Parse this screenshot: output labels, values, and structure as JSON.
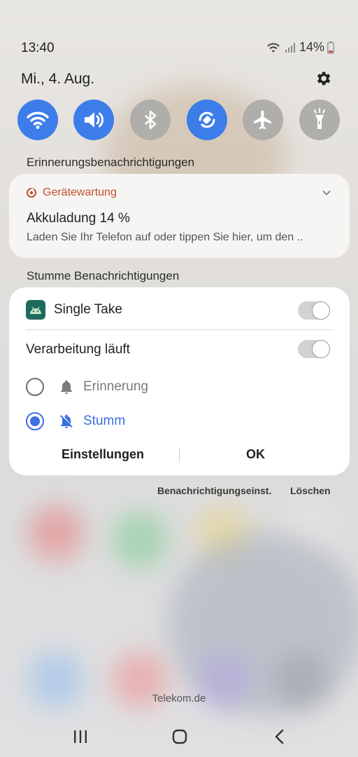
{
  "status_bar": {
    "time": "13:40",
    "battery": "14%"
  },
  "header": {
    "date": "Mi., 4. Aug."
  },
  "quick_settings": [
    {
      "name": "wifi",
      "state": "on"
    },
    {
      "name": "sound",
      "state": "on"
    },
    {
      "name": "bluetooth",
      "state": "off"
    },
    {
      "name": "auto-rotate",
      "state": "on"
    },
    {
      "name": "airplane",
      "state": "off"
    },
    {
      "name": "flashlight",
      "state": "off"
    }
  ],
  "sections": {
    "reminders_title": "Erinnerungsbenachrichtigungen",
    "silent_title": "Stumme Benachrichtigungen"
  },
  "reminder_card": {
    "app_name": "Gerätewartung",
    "title": "Akkuladung 14 %",
    "text": "Laden Sie Ihr Telefon auf oder tippen Sie hier, um den .."
  },
  "popup": {
    "app_name": "Single Take",
    "app_toggle": "off",
    "channel_label": "Verarbeitung läuft",
    "channel_toggle": "off",
    "options": [
      {
        "label": "Erinnerung",
        "selected": false
      },
      {
        "label": "Stumm",
        "selected": true
      }
    ],
    "settings_button": "Einstellungen",
    "ok_button": "OK"
  },
  "footer_links": {
    "notification_settings": "Benachrichtigungseinst.",
    "clear": "Löschen"
  },
  "carrier": "Telekom.de",
  "colors": {
    "accent": "#3c7dea",
    "selected": "#3c6fe0",
    "warning_app": "#c4502b"
  }
}
